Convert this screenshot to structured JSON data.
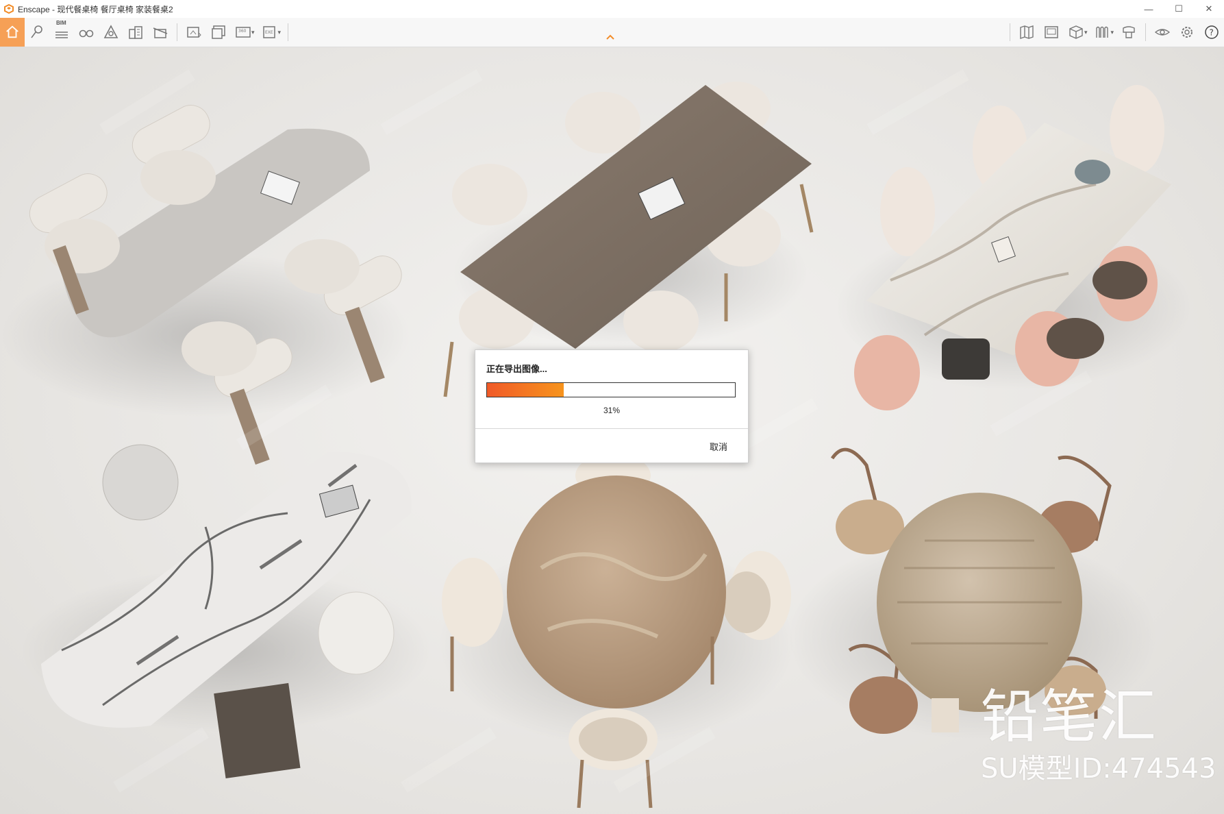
{
  "window": {
    "title": "Enscape - 现代餐桌椅 餐厅桌椅 家装餐桌2",
    "minimize": "—",
    "maximize": "☐",
    "close": "✕"
  },
  "toolbar": {
    "bim_label": "BIM",
    "icons_left": [
      "home-icon",
      "location-pin-icon",
      "bim-icon",
      "binoculars-icon",
      "perspective-icon",
      "building-icon",
      "section-icon",
      "screenshot-icon",
      "batch-render-icon",
      "panorama-360-icon",
      "export-exe-icon"
    ],
    "icons_right": [
      "map-icon",
      "view-management-icon",
      "cube-icon",
      "asset-library-icon",
      "collaborative-annotations-icon",
      "visual-settings-icon",
      "settings-icon",
      "help-icon"
    ],
    "accent_color": "#f6a056"
  },
  "dialog": {
    "title": "正在导出图像...",
    "progress": 0.31,
    "progress_text": "31%",
    "cancel_label": "取消"
  },
  "viewport": {
    "watermark_logo": "铅笔汇",
    "watermark_id": "SU模型ID:474543"
  }
}
